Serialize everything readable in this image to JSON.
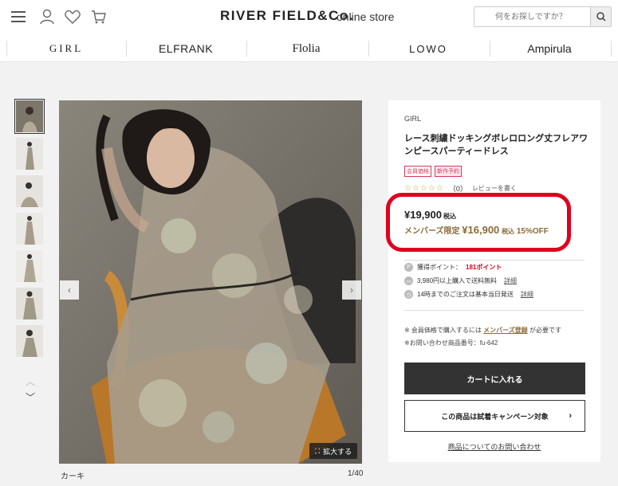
{
  "header": {
    "logo": "RIVER FIELD&Co.",
    "logo_sub": "online store",
    "search_placeholder": "何をお探しですか？",
    "icons": [
      "menu-icon",
      "user-icon",
      "heart-icon",
      "cart-icon",
      "search-icon"
    ]
  },
  "brands": [
    "GIRL",
    "ELFRANK",
    "Flolia",
    "LOWO",
    "Ampirula"
  ],
  "gallery": {
    "thumbnail_count": 7,
    "active_thumbnail": 1,
    "color_label": "カーキ",
    "counter": "1/40",
    "zoom_label": "拡大する"
  },
  "product": {
    "brand": "GIRL",
    "title": "レース刺繍ドッキングボレロロング丈フレアワンピースパーティードレス",
    "tags": [
      "会員価格",
      "新作予約"
    ],
    "rating_count": "（0）",
    "review_link": "レビューを書く",
    "price": "¥19,900",
    "tax_label": "税込",
    "member_label": "メンバーズ限定",
    "member_price": "¥16,900",
    "member_tax": "税込",
    "discount": "15%OFF",
    "points_prefix": "獲得ポイント：",
    "points_value": "181ポイント",
    "shipping_text": "3,980円以上購入で送料無料",
    "shipping_link": "詳細",
    "dispatch_text": "14時までのご注文は基本当日発送",
    "dispatch_link": "詳細",
    "member_note_prefix": "※ 会員価格で購入するには",
    "member_note_link": "メンバーズ登録",
    "member_note_suffix": "が必要です",
    "inquiry_code": "※お問い合わせ商品番号：fu-642",
    "cart_button": "カートに入れる",
    "trial_button": "この商品は試着キャンペーン対象",
    "inquiry_link": "商品についてのお問い合わせ"
  },
  "colors": {
    "accent_red": "#e0001e",
    "member_gold": "#8b6b3a",
    "cart_bg": "#333333"
  }
}
